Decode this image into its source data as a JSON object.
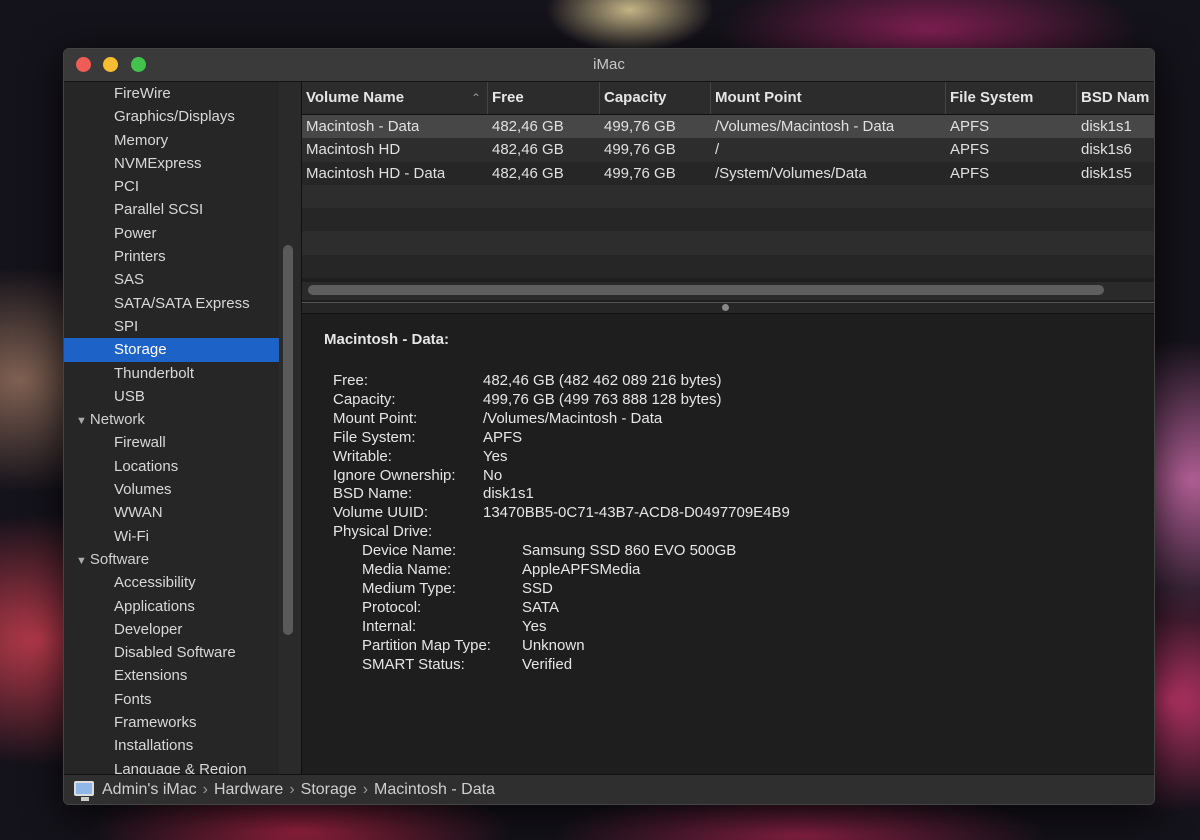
{
  "window": {
    "title": "iMac"
  },
  "sidebar": {
    "items": [
      {
        "label": "FireWire",
        "type": "item"
      },
      {
        "label": "Graphics/Displays",
        "type": "item"
      },
      {
        "label": "Memory",
        "type": "item"
      },
      {
        "label": "NVMExpress",
        "type": "item"
      },
      {
        "label": "PCI",
        "type": "item"
      },
      {
        "label": "Parallel SCSI",
        "type": "item"
      },
      {
        "label": "Power",
        "type": "item"
      },
      {
        "label": "Printers",
        "type": "item"
      },
      {
        "label": "SAS",
        "type": "item"
      },
      {
        "label": "SATA/SATA Express",
        "type": "item"
      },
      {
        "label": "SPI",
        "type": "item"
      },
      {
        "label": "Storage",
        "type": "item",
        "selected": true
      },
      {
        "label": "Thunderbolt",
        "type": "item"
      },
      {
        "label": "USB",
        "type": "item"
      },
      {
        "label": "Network",
        "type": "header"
      },
      {
        "label": "Firewall",
        "type": "item"
      },
      {
        "label": "Locations",
        "type": "item"
      },
      {
        "label": "Volumes",
        "type": "item"
      },
      {
        "label": "WWAN",
        "type": "item"
      },
      {
        "label": "Wi-Fi",
        "type": "item"
      },
      {
        "label": "Software",
        "type": "header"
      },
      {
        "label": "Accessibility",
        "type": "item"
      },
      {
        "label": "Applications",
        "type": "item"
      },
      {
        "label": "Developer",
        "type": "item"
      },
      {
        "label": "Disabled Software",
        "type": "item"
      },
      {
        "label": "Extensions",
        "type": "item"
      },
      {
        "label": "Fonts",
        "type": "item"
      },
      {
        "label": "Frameworks",
        "type": "item"
      },
      {
        "label": "Installations",
        "type": "item"
      },
      {
        "label": "Language & Region",
        "type": "item"
      }
    ]
  },
  "table": {
    "columns": [
      "Volume Name",
      "Free",
      "Capacity",
      "Mount Point",
      "File System",
      "BSD Nam"
    ],
    "rows": [
      [
        "Macintosh - Data",
        "482,46 GB",
        "499,76 GB",
        "/Volumes/Macintosh - Data",
        "APFS",
        "disk1s1"
      ],
      [
        "Macintosh HD",
        "482,46 GB",
        "499,76 GB",
        "/",
        "APFS",
        "disk1s6"
      ],
      [
        "Macintosh HD - Data",
        "482,46 GB",
        "499,76 GB",
        "/System/Volumes/Data",
        "APFS",
        "disk1s5"
      ]
    ],
    "selected_row": 0
  },
  "detail": {
    "title": "Macintosh - Data:",
    "fields": [
      {
        "key": "Free:",
        "value": "482,46 GB (482 462 089 216 bytes)"
      },
      {
        "key": "Capacity:",
        "value": "499,76 GB (499 763 888 128 bytes)"
      },
      {
        "key": "Mount Point:",
        "value": "/Volumes/Macintosh - Data"
      },
      {
        "key": "File System:",
        "value": "APFS"
      },
      {
        "key": "Writable:",
        "value": "Yes"
      },
      {
        "key": "Ignore Ownership:",
        "value": "No"
      },
      {
        "key": "BSD Name:",
        "value": "disk1s1"
      },
      {
        "key": "Volume UUID:",
        "value": "13470BB5-0C71-43B7-ACD8-D0497709E4B9"
      },
      {
        "key": "Physical Drive:",
        "value": ""
      }
    ],
    "physical_drive": [
      {
        "key": "Device Name:",
        "value": "Samsung SSD 860 EVO 500GB"
      },
      {
        "key": "Media Name:",
        "value": "AppleAPFSMedia"
      },
      {
        "key": "Medium Type:",
        "value": "SSD"
      },
      {
        "key": "Protocol:",
        "value": "SATA"
      },
      {
        "key": "Internal:",
        "value": "Yes"
      },
      {
        "key": "Partition Map Type:",
        "value": "Unknown"
      },
      {
        "key": "SMART Status:",
        "value": "Verified"
      }
    ]
  },
  "statusbar": {
    "icon": "imac-icon",
    "breadcrumb": [
      "Admin's iMac",
      "Hardware",
      "Storage",
      "Macintosh - Data"
    ]
  },
  "colors": {
    "selection": "#1d63c7",
    "close": "#ee5c55",
    "minimize": "#f7bd30",
    "maximize": "#43c24d"
  }
}
